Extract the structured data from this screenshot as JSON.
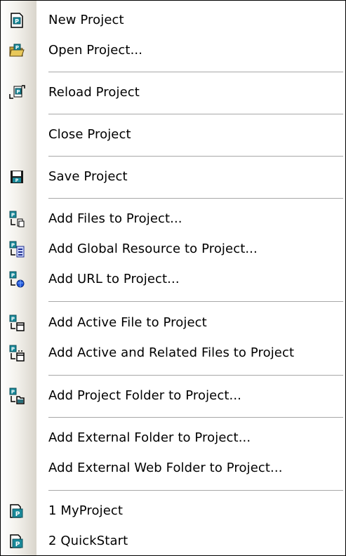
{
  "menu": {
    "items": [
      {
        "label": "New Project",
        "icon": "new-project-icon"
      },
      {
        "label": "Open Project...",
        "icon": "open-project-icon"
      },
      {
        "label": "Reload Project",
        "icon": "reload-project-icon"
      },
      {
        "label": "Close Project",
        "icon": ""
      },
      {
        "label": "Save Project",
        "icon": "save-project-icon"
      },
      {
        "label": "Add Files to Project...",
        "icon": "add-files-icon"
      },
      {
        "label": "Add Global Resource to Project...",
        "icon": "add-global-resource-icon"
      },
      {
        "label": "Add URL to Project...",
        "icon": "add-url-icon"
      },
      {
        "label": "Add Active File to Project",
        "icon": "add-active-file-icon"
      },
      {
        "label": "Add Active and Related Files to Project",
        "icon": "add-related-files-icon"
      },
      {
        "label": "Add Project Folder to Project...",
        "icon": "add-project-folder-icon"
      },
      {
        "label": "Add External Folder to Project...",
        "icon": ""
      },
      {
        "label": "Add External Web Folder to Project...",
        "icon": ""
      },
      {
        "label": "1 MyProject",
        "icon": "recent-project-icon"
      },
      {
        "label": "2 QuickStart",
        "icon": "recent-project-icon"
      }
    ]
  }
}
